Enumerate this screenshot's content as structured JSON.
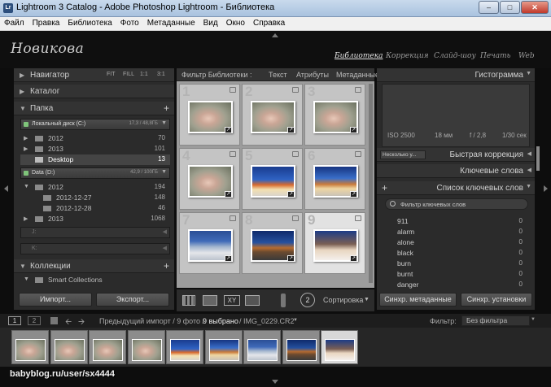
{
  "window": {
    "title": "Lightroom 3 Catalog - Adobe Photoshop Lightroom - Библиотека",
    "app_icon": "Lr"
  },
  "menu": [
    "Файл",
    "Правка",
    "Библиотека",
    "Фото",
    "Метаданные",
    "Вид",
    "Окно",
    "Справка"
  ],
  "identity_plate": "Новикова",
  "modules": [
    "Библиотека",
    "Коррекция",
    "Слайд-шоу",
    "Печать",
    "Web"
  ],
  "left": {
    "navigator": {
      "label": "Навигатор",
      "zoom": [
        "FIT",
        "FILL",
        "1:1",
        "3:1"
      ]
    },
    "catalog": {
      "label": "Каталог"
    },
    "folders": {
      "label": "Папка",
      "add": "+",
      "volume_c": {
        "name": "Локальный диск (C:)",
        "size": "17,3 / 48,8ГБ"
      },
      "volume_d": {
        "name": "Data (D:)",
        "size": "42,9 / 100ГБ"
      },
      "items": [
        {
          "name": "2012",
          "count": "70"
        },
        {
          "name": "2013",
          "count": "101"
        },
        {
          "name": "Desktop",
          "count": "13"
        },
        {
          "name": "2012",
          "count": "194"
        },
        {
          "name": "2012-12-27",
          "count": "148"
        },
        {
          "name": "2012-12-28",
          "count": "46"
        },
        {
          "name": "2013",
          "count": "1068"
        }
      ],
      "collapsed_rows": [
        "J:",
        "K:"
      ]
    },
    "collections": {
      "label": "Коллекции",
      "add": "+",
      "item": "Smart Collections"
    },
    "import_button": "Импорт...",
    "export_button": "Экспорт..."
  },
  "filterbar": {
    "title": "Фильтр Библиотеки :",
    "tabs": [
      "Текст",
      "Атрибуты",
      "Метаданные"
    ]
  },
  "grid": {
    "numbers": [
      "1",
      "2",
      "3",
      "4",
      "5",
      "6",
      "7",
      "8",
      "9"
    ]
  },
  "toolbar": {
    "sort": "Сортировка",
    "sort_arrow": "▼",
    "flag_badge": "2"
  },
  "right": {
    "histogram": {
      "label": "Гистограмма",
      "iso": "ISO 2500",
      "focal": "18 мм",
      "aperture": "f / 2,8",
      "shutter": "1/30 сек"
    },
    "quick": {
      "preset": "Несколько у...",
      "label": "Быстрая коррекция"
    },
    "keywording": {
      "label": "Ключевые слова"
    },
    "keyword_list": {
      "label": "Список ключевых слов",
      "add": "+",
      "filter": "Фильтр ключевых слов",
      "items": [
        {
          "name": "911",
          "count": "0"
        },
        {
          "name": "alarm",
          "count": "0"
        },
        {
          "name": "alone",
          "count": "0"
        },
        {
          "name": "black",
          "count": "0"
        },
        {
          "name": "burn",
          "count": "0"
        },
        {
          "name": "burnt",
          "count": "0"
        },
        {
          "name": "danger",
          "count": "0"
        }
      ]
    },
    "sync_metadata": "Синхр. метаданные",
    "sync_settings": "Синхр. установки"
  },
  "filmstrip": {
    "view1": "1",
    "view2": "2",
    "path": "Предыдущий импорт / 9 фото /",
    "selected": "9 выбрано",
    "file": "/ IMG_0229.CR2",
    "filter_label": "Фильтр:",
    "filter_value": "Без фильтра"
  },
  "watermark": "babyblog.ru/user/sx4444",
  "colors": {
    "accent": "#ffffff",
    "panel": "#2b2b2b",
    "grid": "#9c9c9c"
  }
}
